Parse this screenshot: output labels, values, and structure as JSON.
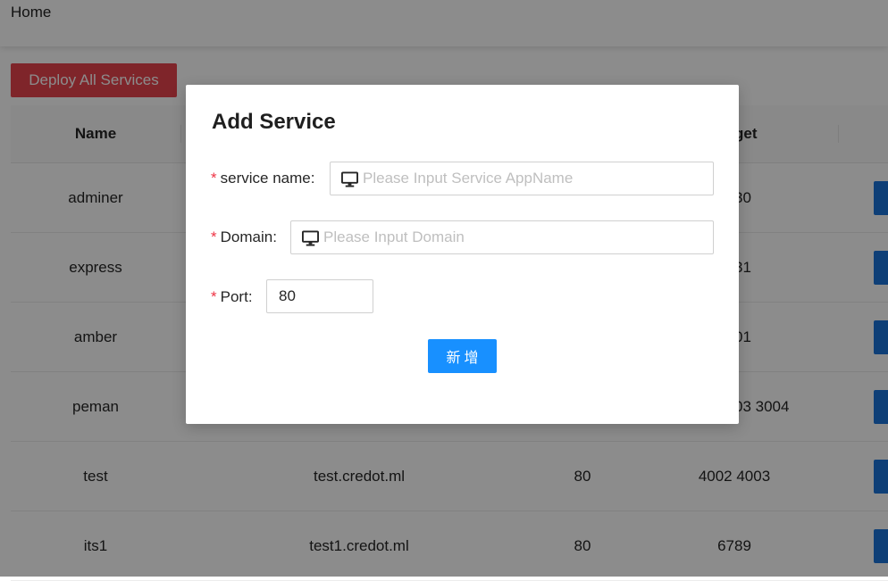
{
  "header": {
    "title": "Home"
  },
  "toolbar": {
    "deploy_all_label": "Deploy All Services"
  },
  "table": {
    "columns": {
      "name": "Name",
      "target_partial": "get"
    },
    "rows": [
      {
        "name": "adminer",
        "domain": "",
        "port": "",
        "target": "30"
      },
      {
        "name": "express",
        "domain": "",
        "port": "",
        "target": "31"
      },
      {
        "name": "amber",
        "domain": "",
        "port": "",
        "target": "01"
      },
      {
        "name": "peman",
        "domain": "",
        "port": "",
        "target": "03 3004"
      },
      {
        "name": "test",
        "domain": "test.credot.ml",
        "port": "80",
        "target": "4002 4003"
      },
      {
        "name": "its1",
        "domain": "test1.credot.ml",
        "port": "80",
        "target": "6789"
      }
    ]
  },
  "modal": {
    "title": "Add Service",
    "required_mark": "*",
    "fields": {
      "service_name": {
        "label": "service name",
        "placeholder": "Please Input Service AppName",
        "value": "",
        "icon": "desktop-icon"
      },
      "domain": {
        "label": "Domain",
        "placeholder": "Please Input Domain",
        "value": "",
        "icon": "desktop-icon"
      },
      "port": {
        "label": "Port",
        "value": "80"
      }
    },
    "submit_label": "新增"
  },
  "colors": {
    "primary": "#1890ff",
    "danger": "#e8444e",
    "required": "#ee3344",
    "mask": "rgba(0,0,0,0.45)"
  }
}
